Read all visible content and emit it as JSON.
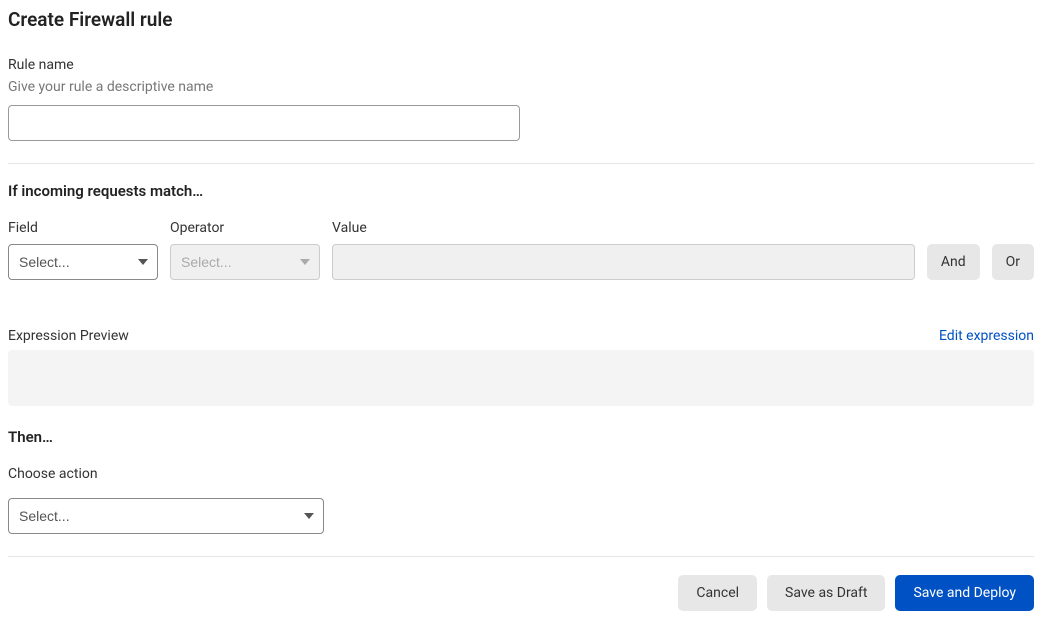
{
  "page": {
    "title": "Create Firewall rule"
  },
  "ruleName": {
    "label": "Rule name",
    "help": "Give your rule a descriptive name",
    "value": ""
  },
  "match": {
    "heading": "If incoming requests match…",
    "fieldLabel": "Field",
    "operatorLabel": "Operator",
    "valueLabel": "Value",
    "fieldPlaceholder": "Select...",
    "operatorPlaceholder": "Select...",
    "valueValue": "",
    "andLabel": "And",
    "orLabel": "Or"
  },
  "preview": {
    "label": "Expression Preview",
    "editLink": "Edit expression",
    "content": ""
  },
  "then": {
    "heading": "Then…",
    "actionLabel": "Choose action",
    "actionPlaceholder": "Select..."
  },
  "footer": {
    "cancel": "Cancel",
    "saveDraft": "Save as Draft",
    "saveDeploy": "Save and Deploy"
  }
}
